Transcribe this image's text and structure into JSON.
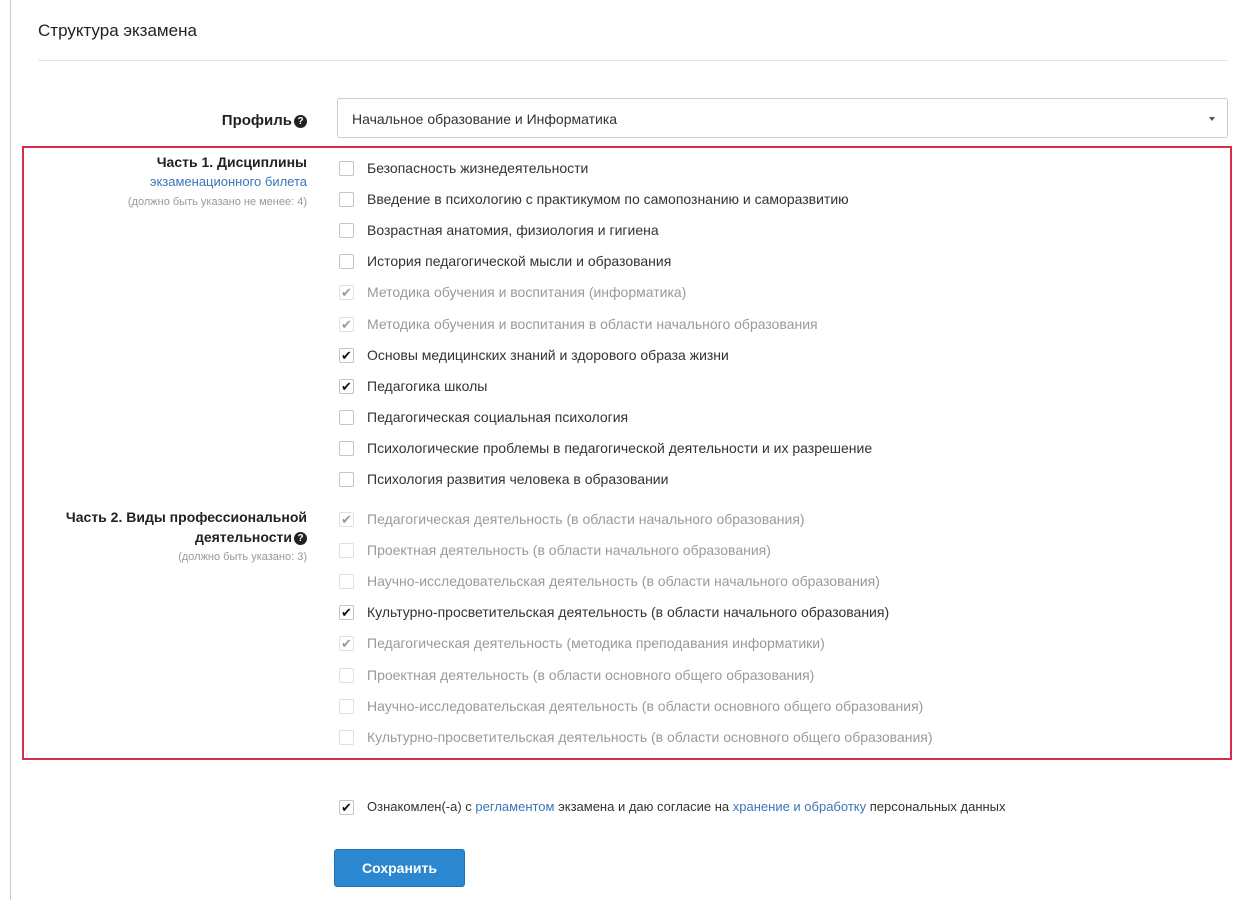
{
  "panel": {
    "title": "Структура экзамена"
  },
  "profile": {
    "label": "Профиль",
    "help_icon": "?",
    "selected": "Начальное образование и Информатика"
  },
  "part1": {
    "title": "Часть 1. Дисциплины",
    "link": "экзаменационного билета",
    "hint": "(должно быть указано не менее: 4)",
    "items": [
      {
        "label": "Безопасность жизнедеятельности",
        "checked": false,
        "disabled": false
      },
      {
        "label": "Введение в психологию с практикумом по самопознанию и саморазвитию",
        "checked": false,
        "disabled": false
      },
      {
        "label": "Возрастная анатомия, физиология и гигиена",
        "checked": false,
        "disabled": false
      },
      {
        "label": "История педагогической мысли и образования",
        "checked": false,
        "disabled": false
      },
      {
        "label": "Методика обучения и воспитания (информатика)",
        "checked": true,
        "disabled": true
      },
      {
        "label": "Методика обучения и воспитания в области начального образования",
        "checked": true,
        "disabled": true
      },
      {
        "label": "Основы медицинских знаний и здорового образа жизни",
        "checked": true,
        "disabled": false
      },
      {
        "label": "Педагогика школы",
        "checked": true,
        "disabled": false
      },
      {
        "label": "Педагогическая социальная психология",
        "checked": false,
        "disabled": false
      },
      {
        "label": "Психологические проблемы в педагогической деятельности и их разрешение",
        "checked": false,
        "disabled": false
      },
      {
        "label": "Психология развития человека в образовании",
        "checked": false,
        "disabled": false
      }
    ]
  },
  "part2": {
    "title_line1": "Часть 2. Виды профессиональной",
    "title_line2": "деятельности",
    "help_icon": "?",
    "hint": "(должно быть указано: 3)",
    "items": [
      {
        "label": "Педагогическая деятельность (в области начального образования)",
        "checked": true,
        "disabled": true
      },
      {
        "label": "Проектная деятельность (в области начального образования)",
        "checked": false,
        "disabled": true
      },
      {
        "label": "Научно-исследовательская деятельность (в области начального образования)",
        "checked": false,
        "disabled": true
      },
      {
        "label": "Культурно-просветительская деятельность (в области начального образования)",
        "checked": true,
        "disabled": false
      },
      {
        "label": "Педагогическая деятельность (методика преподавания информатики)",
        "checked": true,
        "disabled": true
      },
      {
        "label": "Проектная деятельность (в области основного общего образования)",
        "checked": false,
        "disabled": true
      },
      {
        "label": "Научно-исследовательская деятельность (в области основного общего образования)",
        "checked": false,
        "disabled": true
      },
      {
        "label": "Культурно-просветительская деятельность (в области основного общего образования)",
        "checked": false,
        "disabled": true
      }
    ]
  },
  "consent": {
    "checked": true,
    "text1": "Ознакомлен(-а) с ",
    "link1": "регламентом",
    "text2": " экзамена и даю согласие на ",
    "link2": "хранение и обработку",
    "text3": " персональных данных"
  },
  "save_label": "Сохранить",
  "check_glyph": "✔",
  "colors": {
    "accent": "#2b87cf",
    "link": "#3a75b8",
    "highlight_border": "#d62e4a"
  }
}
